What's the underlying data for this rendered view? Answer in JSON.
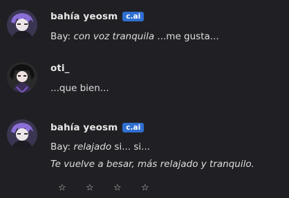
{
  "messages": [
    {
      "author": "bahía yeosm",
      "badge": "c.ai",
      "lines": [
        [
          "Bay: ",
          "con voz tranquila",
          " ...me gusta..."
        ]
      ]
    },
    {
      "author": "oti_",
      "lines": [
        [
          "...que bien..."
        ]
      ]
    },
    {
      "author": "bahía yeosm",
      "badge": "c.ai",
      "lines": [
        [
          "Bay: ",
          "relajado",
          " si... si..."
        ],
        [
          "Te vuelve a besar, más relajado y tranquilo."
        ]
      ]
    }
  ],
  "rating": {
    "stars": [
      "☆",
      "☆",
      "☆",
      "☆"
    ],
    "value": 0
  }
}
